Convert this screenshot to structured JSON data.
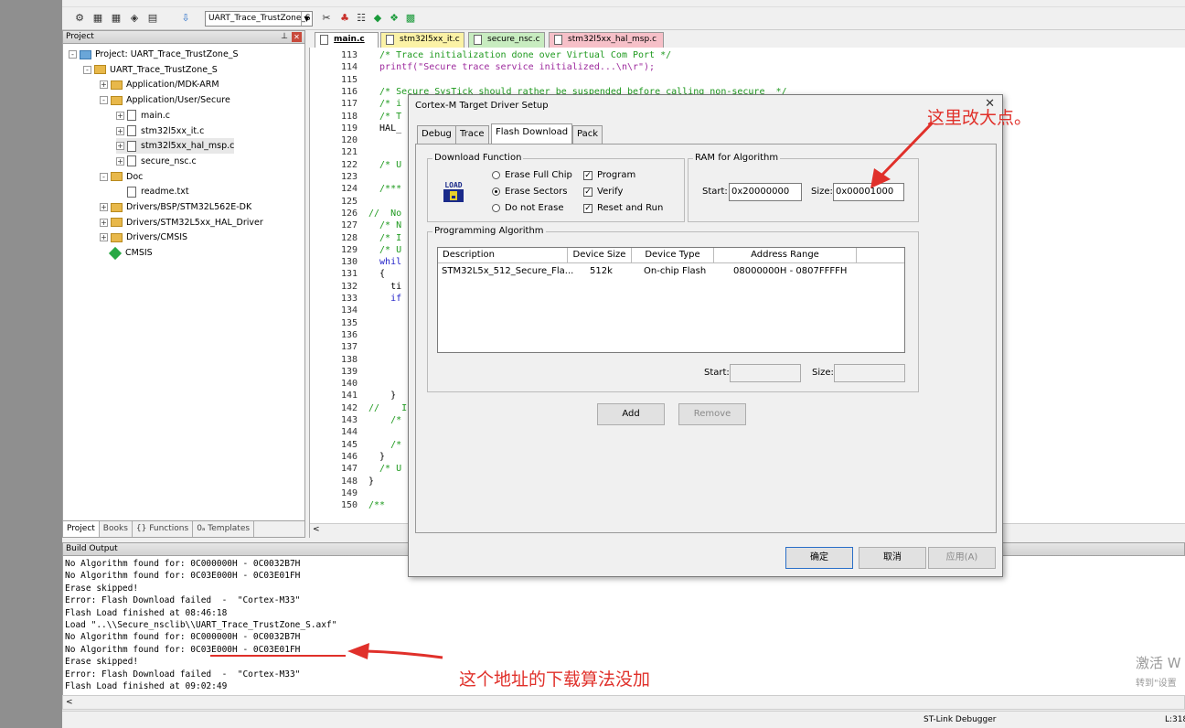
{
  "toolbar": {
    "target_combo": "UART_Trace_TrustZone_S"
  },
  "project_panel": {
    "title": "Project",
    "tree": [
      {
        "label": "Project: UART_Trace_TrustZone_S",
        "level": 0,
        "kind": "project",
        "exp": "-"
      },
      {
        "label": "UART_Trace_TrustZone_S",
        "level": 1,
        "kind": "target",
        "exp": "-"
      },
      {
        "label": "Application/MDK-ARM",
        "level": 2,
        "kind": "folder",
        "exp": "+"
      },
      {
        "label": "Application/User/Secure",
        "level": 2,
        "kind": "folder",
        "exp": "-"
      },
      {
        "label": "main.c",
        "level": 3,
        "kind": "file",
        "exp": "+"
      },
      {
        "label": "stm32l5xx_it.c",
        "level": 3,
        "kind": "file",
        "exp": "+"
      },
      {
        "label": "stm32l5xx_hal_msp.c",
        "level": 3,
        "kind": "file",
        "exp": "+"
      },
      {
        "label": "secure_nsc.c",
        "level": 3,
        "kind": "file",
        "exp": "+"
      },
      {
        "label": "Doc",
        "level": 2,
        "kind": "folder",
        "exp": "-"
      },
      {
        "label": "readme.txt",
        "level": 3,
        "kind": "file",
        "exp": ""
      },
      {
        "label": "Drivers/BSP/STM32L562E-DK",
        "level": 2,
        "kind": "folder",
        "exp": "+"
      },
      {
        "label": "Drivers/STM32L5xx_HAL_Driver",
        "level": 2,
        "kind": "folder",
        "exp": "+"
      },
      {
        "label": "Drivers/CMSIS",
        "level": 2,
        "kind": "folder",
        "exp": "+"
      },
      {
        "label": "CMSIS",
        "level": 2,
        "kind": "gem",
        "exp": ""
      }
    ],
    "tabs": [
      "Project",
      "Books",
      "{} Functions",
      "0ₐ Templates"
    ]
  },
  "editor_tabs": [
    "main.c",
    "stm32l5xx_it.c",
    "secure_nsc.c",
    "stm32l5xx_hal_msp.c"
  ],
  "editor": {
    "lines": [
      {
        "n": "113",
        "code": "  /* Trace initialization done over Virtual Com Port */",
        "cls": "cmt"
      },
      {
        "n": "114",
        "code": "  printf(\"Secure trace service initialized...\\n\\r\");",
        "cls": "str"
      },
      {
        "n": "115",
        "code": "",
        "cls": ""
      },
      {
        "n": "116",
        "code": "  /* Secure SysTick should rather be suspended before calling non-secure  */",
        "cls": "cmt"
      },
      {
        "n": "117",
        "code": "  /* i",
        "cls": "cmt"
      },
      {
        "n": "118",
        "code": "  /* T",
        "cls": "cmt"
      },
      {
        "n": "119",
        "code": "  HAL_",
        "cls": ""
      },
      {
        "n": "120",
        "code": "",
        "cls": ""
      },
      {
        "n": "121",
        "code": "",
        "cls": ""
      },
      {
        "n": "122",
        "code": "  /* U",
        "cls": "cmt"
      },
      {
        "n": "123",
        "code": "",
        "cls": ""
      },
      {
        "n": "124",
        "code": "  /***",
        "cls": "cmt"
      },
      {
        "n": "125",
        "code": "",
        "cls": ""
      },
      {
        "n": "126",
        "code": "//  No",
        "cls": "cmt"
      },
      {
        "n": "127",
        "code": "  /* N",
        "cls": "cmt"
      },
      {
        "n": "128",
        "code": "  /* I",
        "cls": "cmt"
      },
      {
        "n": "129",
        "code": "  /* U",
        "cls": "cmt"
      },
      {
        "n": "130",
        "code": "  whil",
        "cls": "kw"
      },
      {
        "n": "131",
        "code": "  {",
        "cls": ""
      },
      {
        "n": "132",
        "code": "    ti",
        "cls": ""
      },
      {
        "n": "133",
        "code": "    if",
        "cls": "kw"
      },
      {
        "n": "134",
        "code": "      ",
        "cls": ""
      },
      {
        "n": "135",
        "code": "      ",
        "cls": ""
      },
      {
        "n": "136",
        "code": "      ",
        "cls": ""
      },
      {
        "n": "137",
        "code": "",
        "cls": ""
      },
      {
        "n": "138",
        "code": "",
        "cls": ""
      },
      {
        "n": "139",
        "code": "",
        "cls": ""
      },
      {
        "n": "140",
        "code": "",
        "cls": ""
      },
      {
        "n": "141",
        "code": "    }",
        "cls": ""
      },
      {
        "n": "142",
        "code": "//    I",
        "cls": "cmt"
      },
      {
        "n": "143",
        "code": "    /*",
        "cls": "cmt"
      },
      {
        "n": "144",
        "code": "",
        "cls": ""
      },
      {
        "n": "145",
        "code": "    /*",
        "cls": "cmt"
      },
      {
        "n": "146",
        "code": "  }",
        "cls": ""
      },
      {
        "n": "147",
        "code": "  /* U",
        "cls": "cmt"
      },
      {
        "n": "148",
        "code": "}",
        "cls": ""
      },
      {
        "n": "149",
        "code": "",
        "cls": ""
      },
      {
        "n": "150",
        "code": "/**",
        "cls": "cmt"
      }
    ]
  },
  "build_output": {
    "title": "Build Output",
    "lines": [
      "No Algorithm found for: 0C000000H - 0C0032B7H",
      "No Algorithm found for: 0C03E000H - 0C03E01FH",
      "Erase skipped!",
      "Error: Flash Download failed  -  \"Cortex-M33\"",
      "Flash Load finished at 08:46:18",
      "Load \"..\\\\Secure_nsclib\\\\UART_Trace_TrustZone_S.axf\"",
      "No Algorithm found for: 0C000000H - 0C0032B7H",
      "No Algorithm found for: 0C03E000H - 0C03E01FH",
      "Erase skipped!",
      "Error: Flash Download failed  -  \"Cortex-M33\"",
      "Flash Load finished at 09:02:49"
    ]
  },
  "statusbar": {
    "debugger": "ST-Link Debugger",
    "position": "L:318"
  },
  "dialog": {
    "title": "Cortex-M Target Driver Setup",
    "tabs": [
      "Debug",
      "Trace",
      "Flash Download",
      "Pack"
    ],
    "download_function": {
      "label": "Download Function",
      "icon_text": "LOAD",
      "erase_full_chip": "Erase Full Chip",
      "erase_sectors": "Erase Sectors",
      "do_not_erase": "Do not Erase",
      "program": "Program",
      "verify": "Verify",
      "reset_and_run": "Reset and Run"
    },
    "ram": {
      "label": "RAM for Algorithm",
      "start_label": "Start:",
      "start_value": "0x20000000",
      "size_label": "Size:",
      "size_value": "0x00001000"
    },
    "programming_algorithm": {
      "label": "Programming Algorithm",
      "columns": [
        "Description",
        "Device Size",
        "Device Type",
        "Address Range"
      ],
      "rows": [
        {
          "description": "STM32L5x_512_Secure_Fla...",
          "device_size": "512k",
          "device_type": "On-chip Flash",
          "address_range": "08000000H - 0807FFFFH"
        }
      ],
      "start_label": "Start:",
      "size_label": "Size:"
    },
    "add_button": "Add",
    "remove_button": "Remove",
    "ok_button": "确定",
    "cancel_button": "取消",
    "apply_button": "应用(A)"
  },
  "annotations": {
    "top_note": "这里改大点。",
    "bottom_note": "这个地址的下载算法没加",
    "color": "#e0302a"
  },
  "watermark": {
    "line1": "激活 W",
    "line2": "转到\"设置"
  }
}
